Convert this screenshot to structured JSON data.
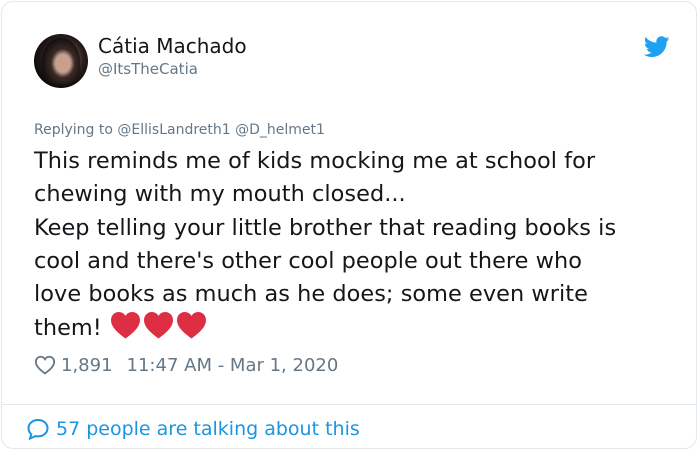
{
  "tweet": {
    "author": {
      "display_name": "Cátia Machado",
      "handle": "@ItsTheCatia"
    },
    "replying_to": {
      "prefix": "Replying to",
      "users": [
        "@EllisLandreth1",
        "@D_helmet1"
      ]
    },
    "text_lines": [
      "This reminds me of kids mocking me at school for",
      "chewing with my mouth closed...",
      "Keep telling your little brother that reading books is",
      "cool and there's other cool people out there who",
      "love books as much as he does; some even write",
      "them!"
    ],
    "emoji": [
      "red-heart",
      "red-heart",
      "red-heart"
    ],
    "likes": "1,891",
    "timestamp": "11:47 AM - Mar 1, 2020",
    "talking_label": "57 people are talking about this"
  },
  "icons": {
    "bird": "twitter-bird-icon",
    "like": "heart-outline-icon",
    "conversation": "speech-bubble-icon"
  },
  "colors": {
    "twitter_blue": "#1da1f2",
    "link_blue": "#1b95e0",
    "text": "#14171a",
    "muted": "#657786",
    "heart_red": "#dd2e44"
  }
}
